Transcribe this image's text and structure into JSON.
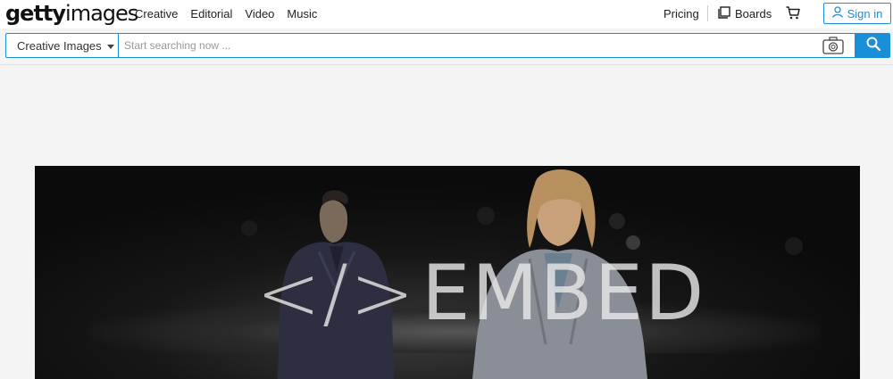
{
  "brand": {
    "logo_bold": "getty",
    "logo_light": "images"
  },
  "nav": {
    "items": [
      "Creative",
      "Editorial",
      "Video",
      "Music"
    ]
  },
  "header_right": {
    "pricing": "Pricing",
    "boards": "Boards",
    "signin": "Sign in"
  },
  "search": {
    "scope": "Creative Images",
    "placeholder": "Start searching now ..."
  },
  "hero": {
    "code_glyph": "</>",
    "word": "EMBED"
  },
  "colors": {
    "accent": "#1a8fd8",
    "background": "#f4f4f4"
  }
}
